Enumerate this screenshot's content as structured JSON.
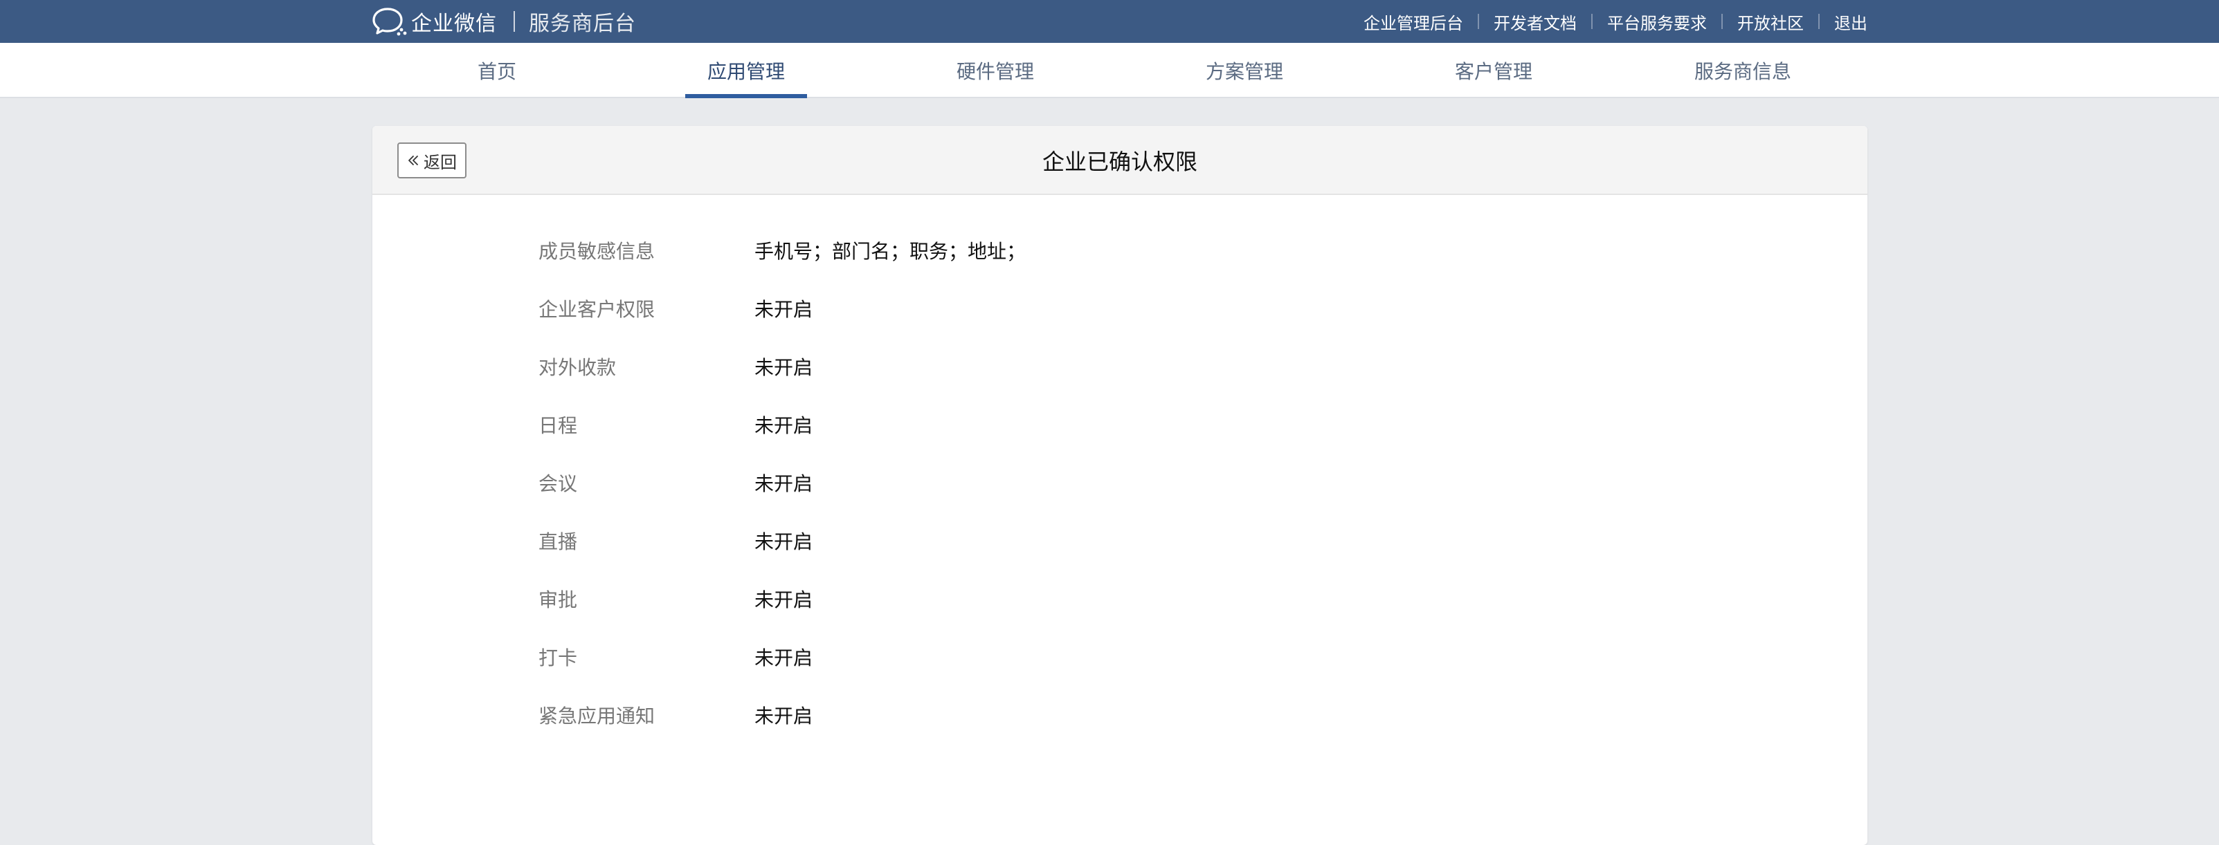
{
  "header": {
    "brand_name": "企业微信",
    "brand_sub": "服务商后台",
    "brand_icon": "wecom-chat-bubble-icon",
    "links": [
      "企业管理后台",
      "开发者文档",
      "平台服务要求",
      "开放社区",
      "退出"
    ]
  },
  "nav": {
    "items": [
      "首页",
      "应用管理",
      "硬件管理",
      "方案管理",
      "客户管理",
      "服务商信息"
    ],
    "active": "应用管理"
  },
  "page": {
    "title": "企业已确认权限",
    "back_label": "返回",
    "back_icon": "double-chevron-left-icon"
  },
  "permissions": [
    {
      "label": "成员敏感信息",
      "value": "手机号；部门名；职务；地址；"
    },
    {
      "label": "企业客户权限",
      "value": "未开启"
    },
    {
      "label": "对外收款",
      "value": "未开启"
    },
    {
      "label": "日程",
      "value": "未开启"
    },
    {
      "label": "会议",
      "value": "未开启"
    },
    {
      "label": "直播",
      "value": "未开启"
    },
    {
      "label": "审批",
      "value": "未开启"
    },
    {
      "label": "打卡",
      "value": "未开启"
    },
    {
      "label": "紧急应用通知",
      "value": "未开启"
    }
  ],
  "colors": {
    "topbar": "#3c5a84",
    "active_underline": "#2f5d9f",
    "background": "#e8eaed"
  }
}
